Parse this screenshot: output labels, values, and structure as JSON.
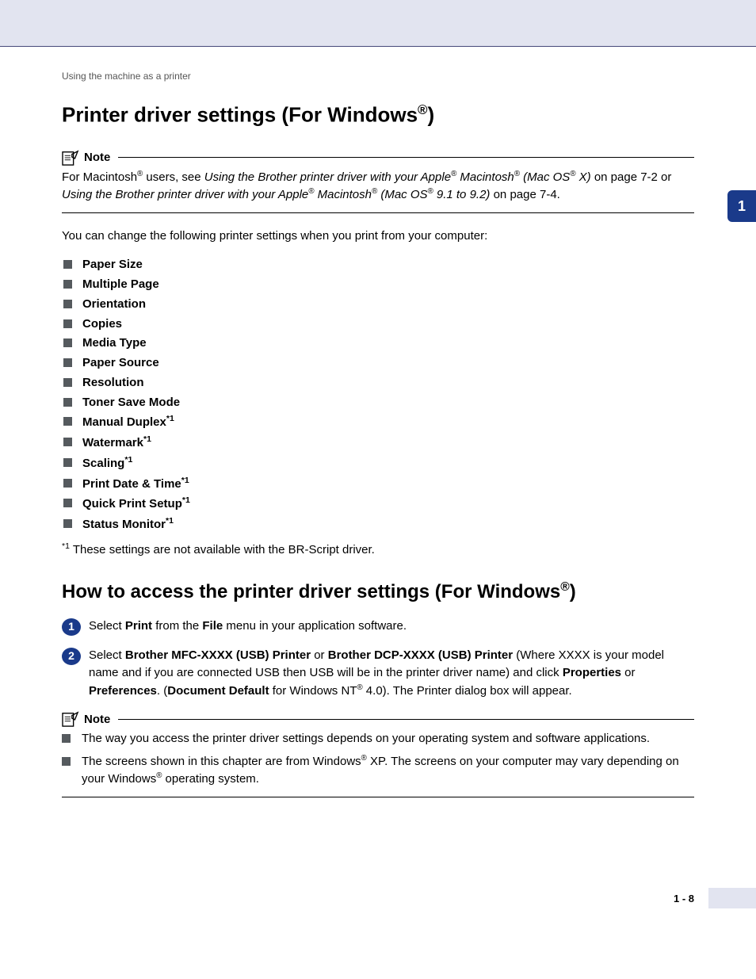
{
  "breadcrumb": "Using the machine as a printer",
  "page_tab": "1",
  "h1_prefix": "Printer driver settings (For Windows",
  "h1_suffix": ")",
  "note_label": "Note",
  "note1_part1": "For Macintosh",
  "note1_part2": " users, see ",
  "note1_italic1": "Using the Brother printer driver with your Apple",
  "note1_italic2": " Macintosh",
  "note1_italic3": " (Mac OS",
  "note1_italic4": " X)",
  "note1_part3": " on page 7-2 or ",
  "note1_italic5": "Using the Brother printer driver with your Apple",
  "note1_italic6": " Macintosh",
  "note1_italic7": " (Mac OS",
  "note1_italic8": " 9.1 to 9.2)",
  "note1_part4": " on page 7-4.",
  "intro": "You can change the following printer settings when you print from your computer:",
  "settings": [
    {
      "label": "Paper Size",
      "fn": false
    },
    {
      "label": "Multiple Page",
      "fn": false
    },
    {
      "label": "Orientation",
      "fn": false
    },
    {
      "label": "Copies",
      "fn": false
    },
    {
      "label": "Media Type",
      "fn": false
    },
    {
      "label": "Paper Source",
      "fn": false
    },
    {
      "label": "Resolution",
      "fn": false
    },
    {
      "label": "Toner Save Mode",
      "fn": false
    },
    {
      "label": "Manual Duplex",
      "fn": true
    },
    {
      "label": "Watermark",
      "fn": true
    },
    {
      "label": "Scaling",
      "fn": true
    },
    {
      "label": "Print Date & Time",
      "fn": true
    },
    {
      "label": "Quick Print Setup",
      "fn": true
    },
    {
      "label": "Status Monitor",
      "fn": true
    }
  ],
  "fn_marker": "*1",
  "footnote_text": " These settings are not available with the BR-Script driver.",
  "h2_prefix": "How to access the printer driver settings (For Windows",
  "h2_suffix": ")",
  "step1_a": "Select ",
  "step1_b": "Print",
  "step1_c": " from the ",
  "step1_d": "File",
  "step1_e": " menu in your application software.",
  "step2_a": "Select ",
  "step2_b": "Brother MFC-XXXX (USB) Printer",
  "step2_c": " or ",
  "step2_d": "Brother DCP-XXXX (USB) Printer",
  "step2_e": " (Where XXXX is your model name and if you are connected USB then USB will be in the printer driver name) and click ",
  "step2_f": "Properties",
  "step2_g": " or ",
  "step2_h": "Preferences",
  "step2_i": ". (",
  "step2_j": "Document Default",
  "step2_k": " for Windows NT",
  "step2_l": " 4.0). The Printer dialog box will appear.",
  "note2_item1": "The way you access the printer driver settings depends on your operating system and software applications.",
  "note2_item2a": "The screens shown in this chapter are from Windows",
  "note2_item2b": " XP. The screens on your computer may vary depending on your Windows",
  "note2_item2c": " operating system.",
  "pagenum": "1 - 8",
  "reg": "®"
}
